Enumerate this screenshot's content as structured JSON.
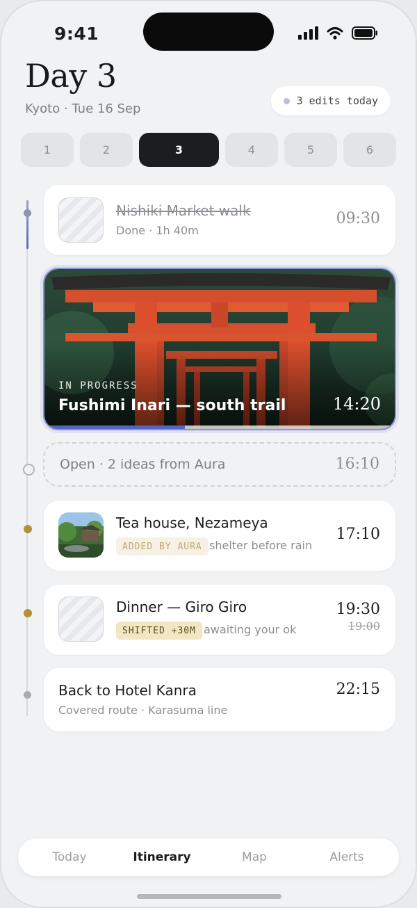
{
  "status_bar": {
    "time": "9:41",
    "icons": [
      "signal-icon",
      "wifi-icon",
      "battery-icon"
    ]
  },
  "header": {
    "title": "Day 3",
    "subtitle": "Kyoto · Tue 16 Sep",
    "edits_badge": "3 edits today"
  },
  "day_tabs": [
    "1",
    "2",
    "3",
    "4",
    "5",
    "6"
  ],
  "active_day": "3",
  "itinerary": {
    "item1": {
      "title": "Nishiki Market walk",
      "subtitle": "Done · 1h 40m",
      "time": "09:30",
      "state": "done"
    },
    "current": {
      "label": "IN PROGRESS",
      "title": "Fushimi Inari — south trail",
      "time": "14:20",
      "progress": 0.4
    },
    "open_slot": {
      "text": "Open · 2 ideas from Aura",
      "time": "16:10"
    },
    "item3": {
      "title": "Tea house, Nezameya",
      "tag": "ADDED BY AURA",
      "note": "shelter before rain",
      "time": "17:10"
    },
    "item4": {
      "title": "Dinner — Giro Giro",
      "tag": "SHIFTED +30M",
      "note": "awaiting your ok",
      "time": "19:30",
      "old_time": "19:00"
    },
    "item5": {
      "title": "Back to Hotel Kanra",
      "subtitle": "Covered route · Karasuma line",
      "time": "22:15"
    }
  },
  "colors": {
    "accent": "#5464c0",
    "aura_gold": "#b0913a",
    "active_tab": "#1c1d20"
  },
  "tab_bar": {
    "today": "Today",
    "itinerary": "Itinerary",
    "map": "Map",
    "alerts": "Alerts",
    "active": "Itinerary"
  }
}
